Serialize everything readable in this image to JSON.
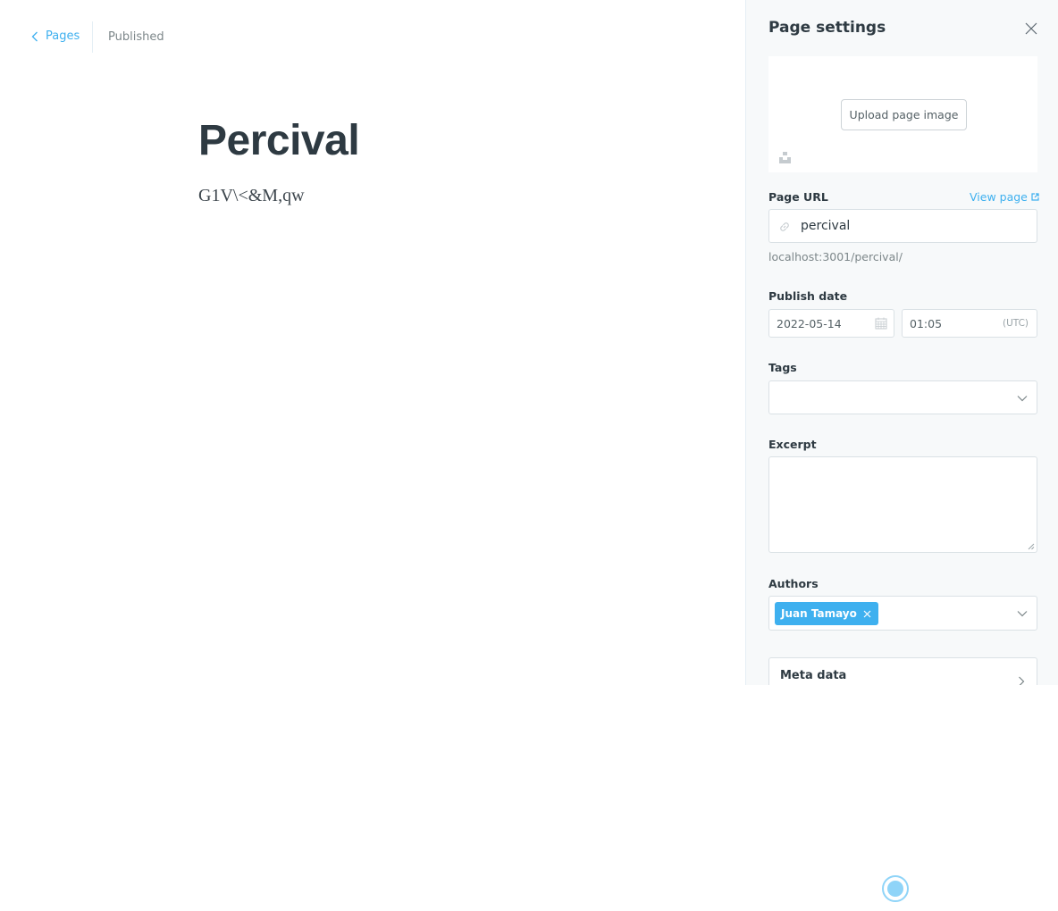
{
  "breadcrumb": {
    "back_label": "Pages",
    "status": "Published"
  },
  "editor": {
    "title": "Percival",
    "body": "G1V\\<&M,qw"
  },
  "settings": {
    "title": "Page settings",
    "upload_label": "Upload page image",
    "url": {
      "label": "Page URL",
      "view_page": "View page",
      "value": "percival",
      "hint": "localhost:3001/percival/"
    },
    "publish": {
      "label": "Publish date",
      "date": "2022-05-14",
      "time": "01:05",
      "timezone": "(UTC)"
    },
    "tags": {
      "label": "Tags",
      "value": ""
    },
    "excerpt": {
      "label": "Excerpt",
      "value": ""
    },
    "authors": {
      "label": "Authors",
      "items": [
        "Juan Tamayo"
      ]
    },
    "meta": {
      "label": "Meta data"
    }
  },
  "colors": {
    "accent": "#3eb0ef",
    "panel_bg": "#f7f9fa",
    "title_text": "#2e3a42"
  },
  "icons": [
    "chevron-left-icon",
    "close-icon",
    "unsplash-icon",
    "link-icon",
    "external-link-icon",
    "calendar-icon",
    "chevron-down-icon",
    "chevron-right-icon"
  ]
}
